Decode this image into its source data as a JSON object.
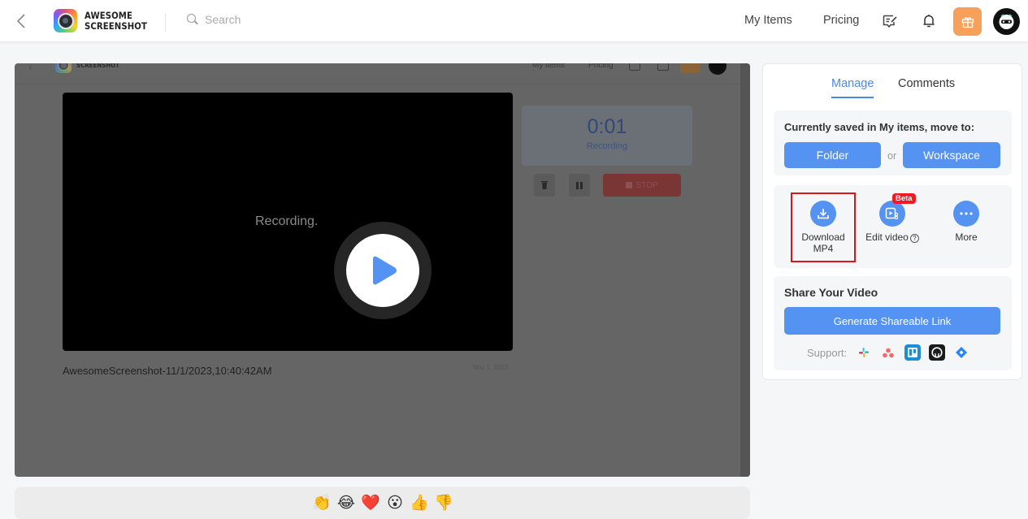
{
  "topbar": {
    "logo_line1": "AWESOME",
    "logo_line2": "SCREENSHOT",
    "search_placeholder": "Search",
    "nav_links": [
      "My Items",
      "Pricing"
    ],
    "icons": [
      "back-chevron-icon",
      "search-icon",
      "feedback-icon",
      "bell-icon",
      "gift-icon",
      "avatar"
    ]
  },
  "video": {
    "overlay_text": "Recording.",
    "title": "AwesomeScreenshot-11/1/2023,10:40:42AM",
    "date": "Nov 1, 2023",
    "timer_value": "0:01",
    "timer_label": "Recording",
    "stop_label": "STOP",
    "inner_nav_links": [
      "My items",
      "Pricing"
    ],
    "inner_logo": "SCREENSHOT"
  },
  "reactions": [
    "👏",
    "😂",
    "❤️",
    "😮",
    "👍",
    "👎"
  ],
  "side": {
    "tabs": [
      {
        "label": "Manage",
        "active": true
      },
      {
        "label": "Comments",
        "active": false
      }
    ],
    "move": {
      "label": "Currently saved in My items, move to:",
      "folder_label": "Folder",
      "or_label": "or",
      "workspace_label": "Workspace"
    },
    "actions": [
      {
        "label_line1": "Download",
        "label_line2": "MP4",
        "icon": "download-icon",
        "highlighted": true
      },
      {
        "label_line1": "Edit video",
        "badge": "Beta",
        "icon": "edit-video-icon"
      },
      {
        "label_line1": "More",
        "icon": "more-dots-icon"
      }
    ],
    "share": {
      "title": "Share Your Video",
      "generate_label": "Generate Shareable Link",
      "support_label": "Support:",
      "integrations": [
        "Slack",
        "Asana",
        "Trello",
        "GitHub",
        "Jira"
      ]
    }
  },
  "colors": {
    "accent": "#5593f2",
    "tab_active": "#4a8ae6",
    "highlight": "#d9141b",
    "beta": "#ed1c24",
    "gift": "#f5a05b"
  }
}
